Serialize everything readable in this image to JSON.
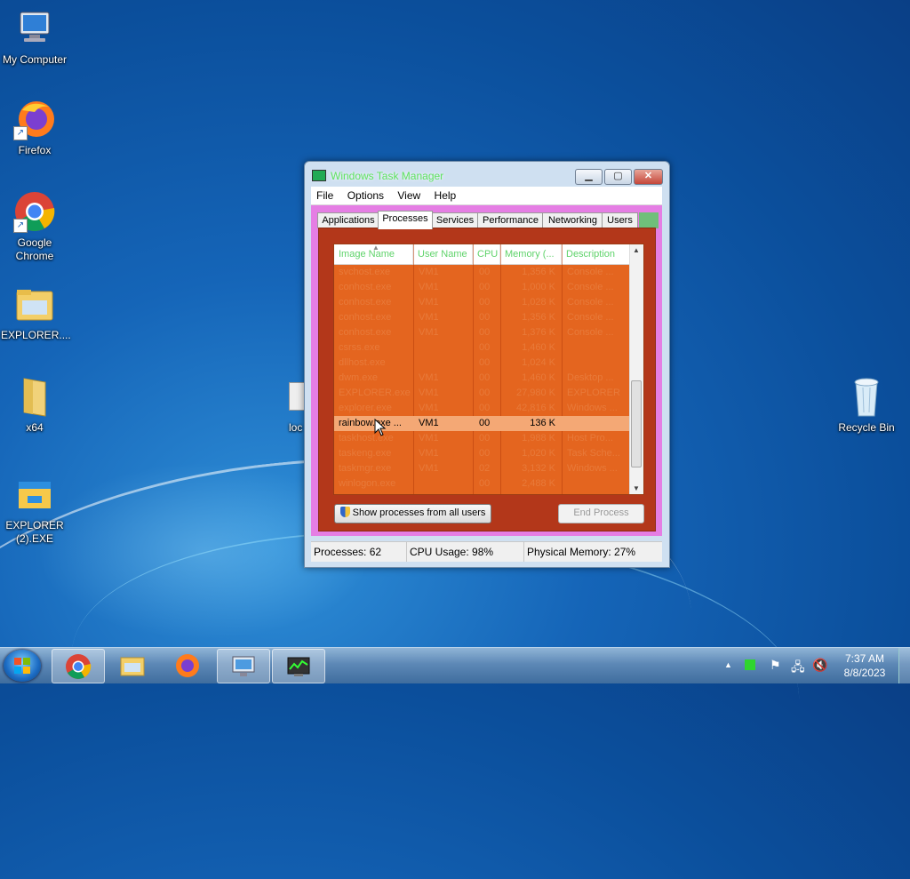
{
  "desktop": {
    "icons": [
      {
        "label": "My Computer"
      },
      {
        "label": "Firefox"
      },
      {
        "label": "Google Chrome"
      },
      {
        "label": "EXPLORER...."
      },
      {
        "label": "x64"
      },
      {
        "label": "EXPLORER (2).EXE"
      },
      {
        "label": "Recycle Bin"
      },
      {
        "label": "loc"
      }
    ]
  },
  "task_manager": {
    "title": "Windows Task Manager",
    "menu": [
      "File",
      "Options",
      "View",
      "Help"
    ],
    "tabs": [
      "Applications",
      "Processes",
      "Services",
      "Performance",
      "Networking",
      "Users"
    ],
    "active_tab": "Processes",
    "columns": [
      "Image Name",
      "User Name",
      "CPU",
      "Memory (...",
      "Description"
    ],
    "rows": [
      {
        "name": "svchost.exe",
        "user": "VM1",
        "cpu": "00",
        "mem": "1,356 K",
        "desc": "Console ..."
      },
      {
        "name": "conhost.exe",
        "user": "VM1",
        "cpu": "00",
        "mem": "1,000 K",
        "desc": "Console ..."
      },
      {
        "name": "conhost.exe",
        "user": "VM1",
        "cpu": "00",
        "mem": "1,028 K",
        "desc": "Console ..."
      },
      {
        "name": "conhost.exe",
        "user": "VM1",
        "cpu": "00",
        "mem": "1,356 K",
        "desc": "Console ..."
      },
      {
        "name": "conhost.exe",
        "user": "VM1",
        "cpu": "00",
        "mem": "1,376 K",
        "desc": "Console ..."
      },
      {
        "name": "csrss.exe",
        "user": "",
        "cpu": "00",
        "mem": "1,460 K",
        "desc": ""
      },
      {
        "name": "dllhost.exe",
        "user": "",
        "cpu": "00",
        "mem": "1,024 K",
        "desc": ""
      },
      {
        "name": "dwm.exe",
        "user": "VM1",
        "cpu": "00",
        "mem": "1,460 K",
        "desc": "Desktop ..."
      },
      {
        "name": "EXPLORER.exe",
        "user": "VM1",
        "cpu": "00",
        "mem": "27,980 K",
        "desc": "EXPLORER"
      },
      {
        "name": "explorer.exe",
        "user": "VM1",
        "cpu": "00",
        "mem": "42,816 K",
        "desc": "Windows ..."
      },
      {
        "name": "rainbow.exe ...",
        "user": "VM1",
        "cpu": "00",
        "mem": "136 K",
        "desc": ""
      },
      {
        "name": "taskhost.exe",
        "user": "VM1",
        "cpu": "00",
        "mem": "1,988 K",
        "desc": "Host Pro..."
      },
      {
        "name": "taskeng.exe",
        "user": "VM1",
        "cpu": "00",
        "mem": "1,020 K",
        "desc": "Task Sche..."
      },
      {
        "name": "taskmgr.exe",
        "user": "VM1",
        "cpu": "02",
        "mem": "3,132 K",
        "desc": "Windows ..."
      },
      {
        "name": "winlogon.exe",
        "user": "",
        "cpu": "00",
        "mem": "2,488 K",
        "desc": ""
      }
    ],
    "selected_row": 10,
    "show_all_label": "Show processes from all users",
    "end_process_label": "End Process",
    "status": {
      "processes": "Processes: 62",
      "cpu": "CPU Usage: 98%",
      "memory": "Physical Memory: 27%"
    }
  },
  "taskbar": {
    "clock_time": "7:37 AM",
    "clock_date": "8/8/2023",
    "items": [
      "start-button",
      "chrome",
      "explorer",
      "firefox",
      "control-panel",
      "task-manager"
    ]
  }
}
